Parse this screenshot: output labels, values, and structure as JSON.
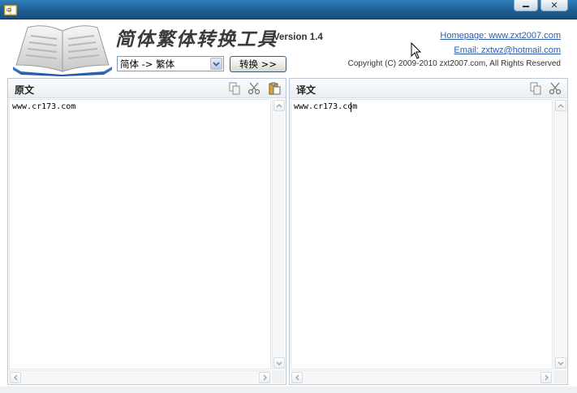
{
  "window": {
    "minimize_icon": "minimize-icon",
    "close_icon": "close-icon"
  },
  "header": {
    "title": "简体繁体转换工具",
    "version": "Version 1.4",
    "mode_select": {
      "value": "简体 -> 繁体"
    },
    "convert_button": "转换 >>",
    "homepage_link": "Homepage: www.zxt2007.com",
    "email_link": "Email: zxtwz@hotmail.com",
    "copyright": "Copyright (C) 2009-2010 zxt2007.com, All Rights Reserved"
  },
  "source_panel": {
    "title": "原文",
    "text": "www.cr173.com",
    "tools": [
      "copy-icon",
      "cut-icon",
      "paste-icon"
    ]
  },
  "target_panel": {
    "title": "译文",
    "text": "www.cr173.com",
    "tools": [
      "copy-icon",
      "cut-icon"
    ]
  },
  "colors": {
    "titlebar": "#1d5e95",
    "link": "#2a5db0",
    "panel_border": "#b9c7d6"
  }
}
